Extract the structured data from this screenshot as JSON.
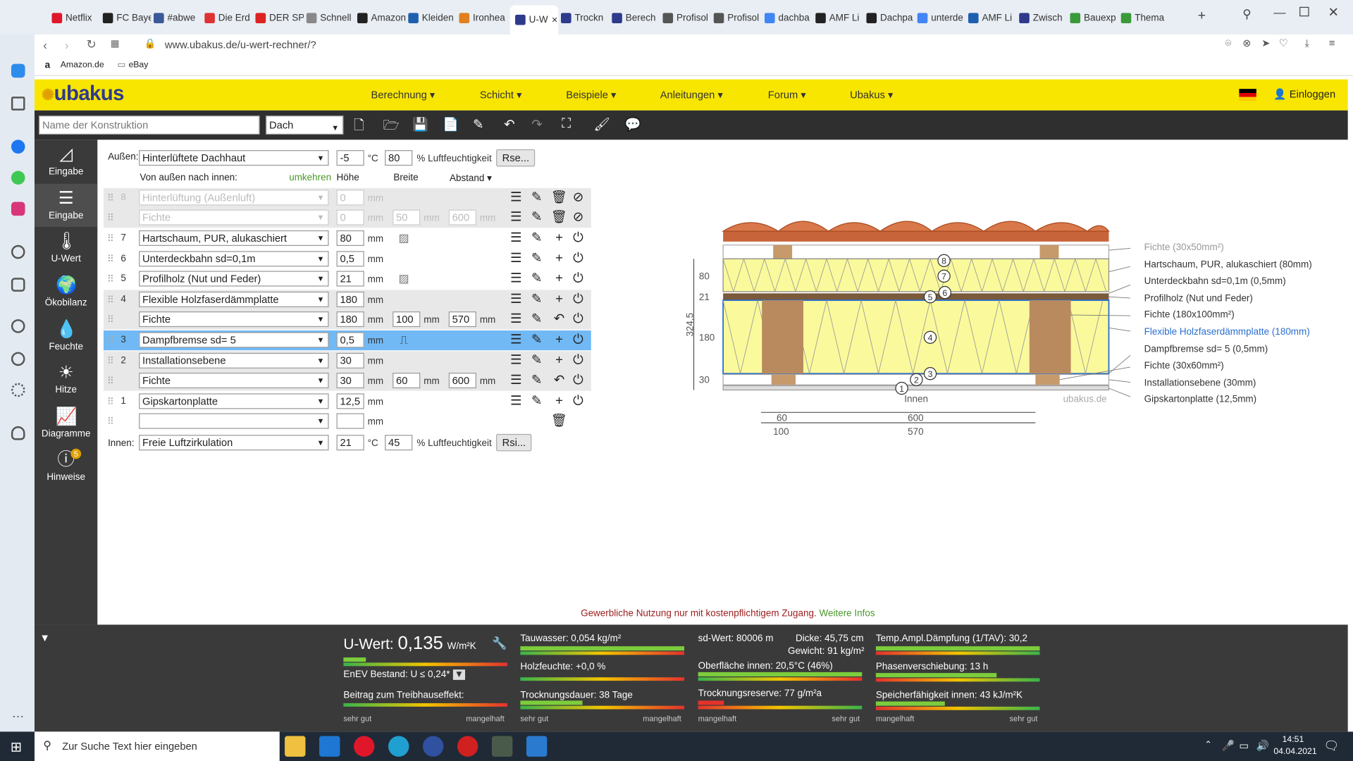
{
  "browser": {
    "tabs": [
      "Netflix",
      "FC Baye",
      "#abwe",
      "Die Erd",
      "DER SP",
      "Schnell",
      "Amazon",
      "Kleiden",
      "Ironhea",
      "U-W",
      "Trockn",
      "Berech",
      "Profisol",
      "Profisol",
      "dachba",
      "AMF Li",
      "Dachpa",
      "unterde",
      "AMF Li",
      "Zwisch",
      "Bauexp",
      "Thema"
    ],
    "url": "www.ubakus.de/u-wert-rechner/?",
    "bookmarks": [
      "Amazon.de",
      "eBay"
    ]
  },
  "header": {
    "logo": "ubakus",
    "nav": [
      "Berechnung",
      "Schicht",
      "Beispiele",
      "Anleitungen",
      "Forum",
      "Ubakus"
    ],
    "login": "Einloggen"
  },
  "toolbar": {
    "name_placeholder": "Name der Konstruktion",
    "type": "Dach"
  },
  "leftnav": [
    "Eingabe",
    "Eingabe",
    "U-Wert",
    "Ökobilanz",
    "Feuchte",
    "Hitze",
    "Diagramme",
    "Hinweise"
  ],
  "hinweise_badge": "5",
  "outside": {
    "label": "Außen:",
    "material": "Hinterlüftete Dachhaut",
    "temp": "-5",
    "temp_unit": "°C",
    "humidity": "80",
    "humidity_unit": "% Luftfeuchtigkeit",
    "button": "Rse..."
  },
  "colheads": {
    "order": "Von außen nach innen:",
    "reverse": "umkehren",
    "height": "Höhe",
    "width": "Breite",
    "distance": "Abstand"
  },
  "layers": [
    {
      "n": "8",
      "mat": "Hinterlüftung (Außenluft)",
      "h": "0",
      "w": "",
      "d": "",
      "disabled": true
    },
    {
      "n": "",
      "mat": "Fichte",
      "h": "0",
      "w": "50",
      "d": "600",
      "disabled": true
    },
    {
      "n": "7",
      "mat": "Hartschaum, PUR, alukaschiert",
      "h": "80",
      "w": "",
      "d": ""
    },
    {
      "n": "6",
      "mat": "Unterdeckbahn sd=0,1m",
      "h": "0,5",
      "w": "",
      "d": ""
    },
    {
      "n": "5",
      "mat": "Profilholz (Nut und Feder)",
      "h": "21",
      "w": "",
      "d": ""
    },
    {
      "n": "4",
      "mat": "Flexible Holzfaserdämmplatte",
      "h": "180",
      "w": "",
      "d": ""
    },
    {
      "n": "",
      "mat": "Fichte",
      "h": "180",
      "w": "100",
      "d": "570"
    },
    {
      "n": "3",
      "mat": "Dampfbremse sd= 5",
      "h": "0,5",
      "w": "",
      "d": ""
    },
    {
      "n": "2",
      "mat": "Installationsebene",
      "h": "30",
      "w": "",
      "d": ""
    },
    {
      "n": "",
      "mat": "Fichte",
      "h": "30",
      "w": "60",
      "d": "600"
    },
    {
      "n": "1",
      "mat": "Gipskartonplatte",
      "h": "12,5",
      "w": "",
      "d": ""
    },
    {
      "n": "",
      "mat": "",
      "h": "",
      "w": "",
      "d": ""
    }
  ],
  "inside": {
    "label": "Innen:",
    "material": "Freie Luftzirkulation",
    "temp": "21",
    "temp_unit": "°C",
    "humidity": "45",
    "humidity_unit": "% Luftfeuchtigkeit",
    "button": "Rsi..."
  },
  "units": {
    "mm": "mm"
  },
  "drawing": {
    "labels": [
      "Fichte (30x50mm²)",
      "Hartschaum, PUR, alukaschiert (80mm)",
      "Unterdeckbahn sd=0,1m (0,5mm)",
      "Profilholz (Nut und Feder)",
      "Fichte (180x100mm²)",
      "Flexible Holzfaserdämmplatte (180mm)",
      "Dampfbremse sd= 5 (0,5mm)",
      "Fichte (30x60mm²)",
      "Installationsebene (30mm)",
      "Gipskartonplatte (12,5mm)"
    ],
    "dims_left": [
      "80",
      "21",
      "180",
      "30"
    ],
    "total": "324,5",
    "dims_bottom": [
      "60",
      "600",
      "100",
      "570"
    ],
    "inside": "Innen",
    "watermark": "ubakus.de",
    "markers": [
      "8",
      "7",
      "6",
      "5",
      "4",
      "3",
      "2",
      "1"
    ]
  },
  "notice": {
    "text": "Gewerbliche Nutzung nur mit kostenpflichtigem Zugang.",
    "link": "Weitere Infos"
  },
  "results": {
    "uwert_label": "U-Wert:",
    "uwert": "0,135",
    "uwert_unit": "W/m²K",
    "enev": "EnEV Bestand: U ≤ 0,24*",
    "treib": "Beitrag zum Treibhauseffekt:",
    "sehr_gut": "sehr gut",
    "mangelhaft": "mangelhaft",
    "tauwasser": "Tauwasser: 0,054 kg/m²",
    "holzfeuchte": "Holzfeuchte: +0,0 %",
    "trocknung": "Trocknungsdauer: 38 Tage",
    "sd": "sd-Wert: 80006 m",
    "dicke": "Dicke: 45,75 cm",
    "gewicht": "Gewicht: 91 kg/m²",
    "oberflaeche": "Oberfläche innen: 20,5°C (46%)",
    "reserve": "Trocknungsreserve: 77 g/m²a",
    "tav": "Temp.Ampl.Dämpfung (1/TAV): 30,2",
    "phase": "Phasenverschiebung: 13 h",
    "speicher": "Speicherfähigkeit innen: 43 kJ/m²K"
  },
  "taskbar": {
    "search": "Zur Suche Text hier eingeben",
    "time": "14:51",
    "date": "04.04.2021"
  }
}
